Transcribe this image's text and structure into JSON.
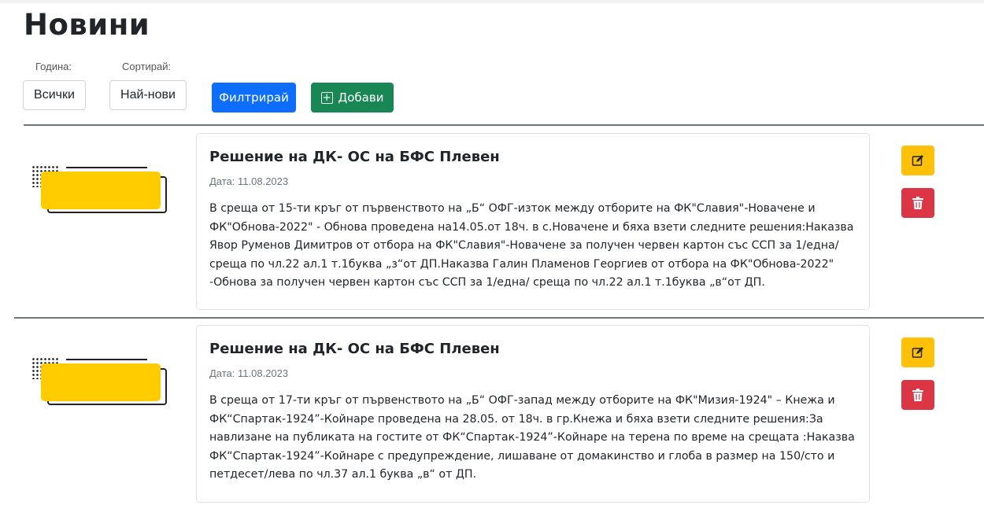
{
  "page": {
    "title": "Новини"
  },
  "filters": {
    "year_label": "Година:",
    "year_value": "Всички",
    "sort_label": "Сортирай:",
    "sort_value": "Най-нови",
    "filter_button": "Филтрирай",
    "add_button": "Добави",
    "add_icon": "plus-square-icon"
  },
  "news": [
    {
      "title": "Решение на ДК- ОС на БФС Плевен",
      "date": "Дата: 11.08.2023",
      "text": "В среща от 15-ти кръг от първенството на „Б“ ОФГ-изток между отборите на ФК\"Славия\"-Новачене и ФК\"Обнова-2022\" - Обнова проведена на14.05.от 18ч. в с.Новачене и бяха взети следните решения:Наказва Явор Руменов Димитров от отбора на ФК\"Славия\"-Новачене за получен червен картон със ССП за 1/една/ среща по чл.22 ал.1 т.1буква „з“от ДП.Наказва Галин Пламенов Георгиев от отбора на ФК\"Обнова-2022\" -Обнова за получен червен картон със ССП за 1/една/ среща по чл.22 ал.1 т.1буква „в“от ДП."
    },
    {
      "title": "Решение на ДК- ОС на БФС Плевен",
      "date": "Дата: 11.08.2023",
      "text": "В среща от 17-ти кръг от първенството на „Б“ ОФГ-запад между отборите на ФК\"Мизия-1924\" – Кнежа и ФК“Спартак-1924”-Койнаре проведена на 28.05. от 18ч. в гр.Кнежа и бяха взети следните решения:За навлизане на публиката на гостите от ФК“Спартак-1924”-Койнаре на терена по време на срещата :Наказва ФК“Спартак-1924”-Койнаре с предупреждение, лишаване от домакинство и глоба в размер на 150/сто и петдесет/лева по чл.37 ал.1 буква „в“ от ДП."
    }
  ],
  "colors": {
    "primary": "#0d6efd",
    "success": "#198754",
    "warning": "#ffc107",
    "danger": "#dc3545",
    "thumb_yellow": "#ffcc00"
  },
  "icons": {
    "edit": "pencil-square-icon",
    "delete": "trash-icon"
  }
}
